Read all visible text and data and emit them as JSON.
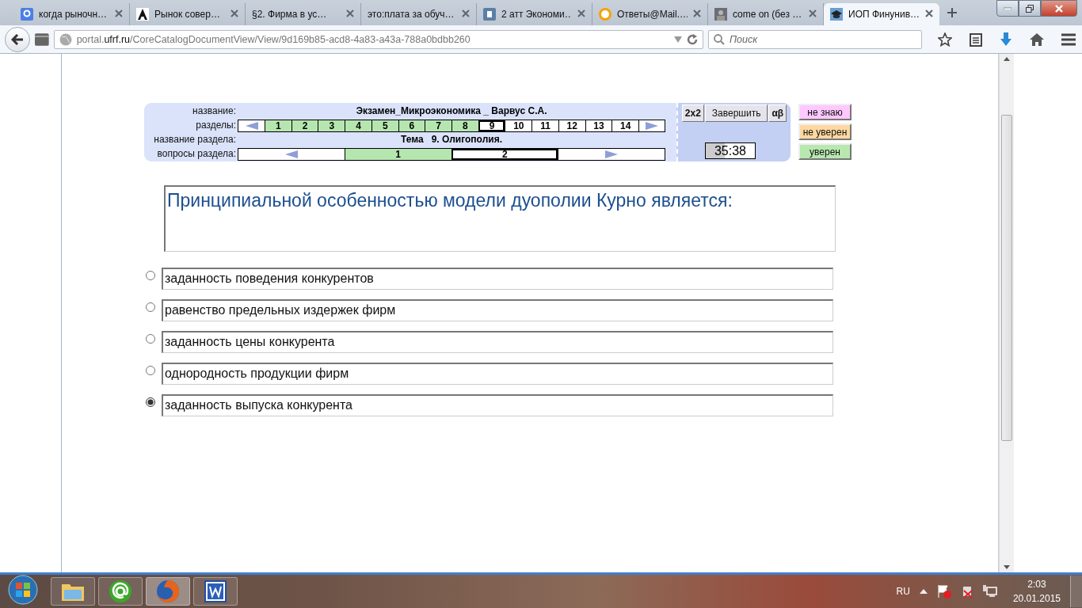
{
  "browser": {
    "tabs": [
      {
        "title": "когда рыночн…",
        "selected": false,
        "kind": "google"
      },
      {
        "title": "Рынок совер…",
        "selected": false,
        "kind": "letter"
      },
      {
        "title": "§2. Фирма в ус…",
        "selected": false,
        "kind": "none"
      },
      {
        "title": "это:плата за обуч…",
        "selected": false,
        "kind": "none"
      },
      {
        "title": "2 атт Экономи…",
        "selected": false,
        "kind": "vk"
      },
      {
        "title": "Ответы@Mail.…",
        "selected": false,
        "kind": "question"
      },
      {
        "title": "come on (без …",
        "selected": false,
        "kind": "photo"
      },
      {
        "title": "ИОП Финунив…",
        "selected": true,
        "kind": "cap"
      }
    ],
    "url": {
      "prefix": "portal.",
      "domain": "ufrf.ru",
      "path": "/CoreCatalogDocumentView/View/9d169b85-acd8-4a83-a43a-788a0bdbb260"
    },
    "search": {
      "placeholder": "Поиск"
    }
  },
  "exam": {
    "labels": {
      "name": "название:",
      "sections": "разделы:",
      "section_name": "название раздела:",
      "questions": "вопросы раздела:"
    },
    "title": "Экзамен_Микроэкономика _ Варвус С.А.",
    "section_title": "Тема   9. Олигополия.",
    "sections": [
      {
        "label": "1",
        "done": true,
        "selected": false
      },
      {
        "label": "2",
        "done": true,
        "selected": false
      },
      {
        "label": "3",
        "done": true,
        "selected": false
      },
      {
        "label": "4",
        "done": true,
        "selected": false
      },
      {
        "label": "5",
        "done": true,
        "selected": false
      },
      {
        "label": "6",
        "done": true,
        "selected": false
      },
      {
        "label": "7",
        "done": true,
        "selected": false
      },
      {
        "label": "8",
        "done": true,
        "selected": false
      },
      {
        "label": "9",
        "done": false,
        "selected": true
      },
      {
        "label": "10",
        "done": false,
        "selected": false
      },
      {
        "label": "11",
        "done": false,
        "selected": false
      },
      {
        "label": "12",
        "done": false,
        "selected": false
      },
      {
        "label": "13",
        "done": false,
        "selected": false
      },
      {
        "label": "14",
        "done": false,
        "selected": false
      }
    ],
    "questions": [
      {
        "label": "1",
        "done": true,
        "selected": false
      },
      {
        "label": "2",
        "done": false,
        "selected": true
      }
    ],
    "buttons": [
      "2x2",
      "Завершить",
      "αβ"
    ],
    "timer": {
      "text": "35:38",
      "level": 0.39
    },
    "confidence": [
      {
        "label": "не знаю",
        "color": "#ffc8ff"
      },
      {
        "label": "не уверен",
        "color": "#ffd8a0"
      },
      {
        "label": "уверен",
        "color": "#b8e8b0"
      }
    ],
    "question": "Принципиальной особенностью модели дуополии Курно является:",
    "answers": [
      {
        "text": "заданность поведения конкурентов",
        "selected": false
      },
      {
        "text": "равенство предельных издержек фирм",
        "selected": false
      },
      {
        "text": "заданность цены конкурента",
        "selected": false
      },
      {
        "text": "однородность продукции фирм",
        "selected": false
      },
      {
        "text": "заданность выпуска конкурента",
        "selected": true
      }
    ]
  },
  "taskbar": {
    "apps": [
      {
        "kind": "folder",
        "selected": false
      },
      {
        "kind": "mail",
        "selected": false
      },
      {
        "kind": "firefox",
        "selected": true
      },
      {
        "kind": "word",
        "selected": false
      }
    ],
    "language": "RU",
    "time": "2:03",
    "date": "20.01.2015"
  }
}
